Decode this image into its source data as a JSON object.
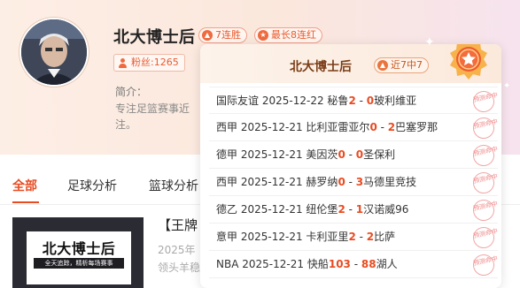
{
  "profile": {
    "name": "北大博士后",
    "streak_badge": "7连胜",
    "best_badge": "最长8连红",
    "fans": "粉丝:1265",
    "intro_label": "简介：",
    "intro_text": "专注足篮赛事近注。"
  },
  "tabs": [
    "全部",
    "足球分析",
    "篮球分析"
  ],
  "article": {
    "thumb_title": "北大博士后",
    "thumb_subtitle": "全天追踪，精析每场赛事",
    "title": "【王牌",
    "meta1": "2025年",
    "meta2": "领头羊稳"
  },
  "popup": {
    "name": "北大博士后",
    "record_badge": "近7中7",
    "stamp_text": "预测命中",
    "matches": [
      {
        "league": "国际友谊",
        "date": "2025-12-22",
        "home": "秘鲁",
        "home_score": "2",
        "sep": " - ",
        "away_score": "0",
        "away": "玻利维亚"
      },
      {
        "league": "西甲",
        "date": "2025-12-21",
        "home": "比利亚雷亚尔",
        "home_score": "0",
        "sep": " - ",
        "away_score": "2",
        "away": "巴塞罗那"
      },
      {
        "league": "德甲",
        "date": "2025-12-21",
        "home": "美因茨",
        "home_score": "0",
        "sep": " - ",
        "away_score": "0",
        "away": "圣保利"
      },
      {
        "league": "西甲",
        "date": "2025-12-21",
        "home": "赫罗纳",
        "home_score": "0",
        "sep": " - ",
        "away_score": "3",
        "away": "马德里竞技"
      },
      {
        "league": "德乙",
        "date": "2025-12-21",
        "home": "纽伦堡",
        "home_score": "2",
        "sep": " - ",
        "away_score": "1",
        "away": "汉诺威96"
      },
      {
        "league": "意甲",
        "date": "2025-12-21",
        "home": "卡利亚里",
        "home_score": "2",
        "sep": " - ",
        "away_score": "2",
        "away": "比萨"
      },
      {
        "league": "NBA",
        "date": "2025-12-21",
        "home": "快船",
        "home_score": "103",
        "sep": " - ",
        "away_score": "88",
        "away": "湖人"
      }
    ]
  },
  "colors": {
    "accent": "#e84c22",
    "popup_title": "#7a3c16",
    "stamp": "#f08a8a"
  },
  "icons": {
    "streak": "flame-icon",
    "best": "thumb-up-icon",
    "fans": "person-icon",
    "medal": "medal-star-icon"
  }
}
